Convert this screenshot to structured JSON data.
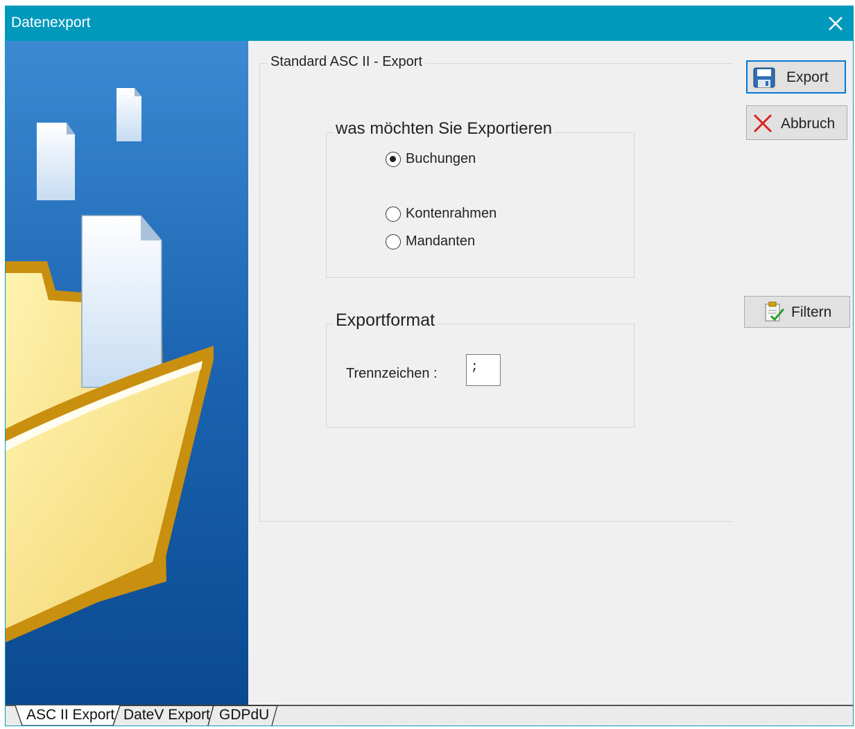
{
  "window": {
    "title": "Datenexport"
  },
  "main_group": {
    "label": "Standard ASC II - Export"
  },
  "export_what": {
    "legend": "was möchten Sie Exportieren",
    "options": [
      {
        "label": "Buchungen",
        "checked": true
      },
      {
        "label": "Kontenrahmen",
        "checked": false
      },
      {
        "label": "Mandanten",
        "checked": false
      }
    ]
  },
  "export_format": {
    "legend": "Exportformat",
    "separator_label": "Trennzeichen :",
    "separator_value": ";"
  },
  "buttons": {
    "export": "Export",
    "cancel": "Abbruch",
    "filter": "Filtern"
  },
  "tabs": [
    {
      "label": "ASC II Export",
      "active": true
    },
    {
      "label": "DateV Export",
      "active": false
    },
    {
      "label": "GDPdU",
      "active": false
    }
  ],
  "icons": {
    "close": "close-icon",
    "export": "floppy-disk-icon",
    "cancel": "red-x-icon",
    "filter": "clipboard-check-icon"
  },
  "colors": {
    "titlebar": "#0099bc",
    "default_button_border": "#0078d7",
    "side_panel_top": "#3a8ad0",
    "side_panel_bottom": "#0a4a90"
  }
}
